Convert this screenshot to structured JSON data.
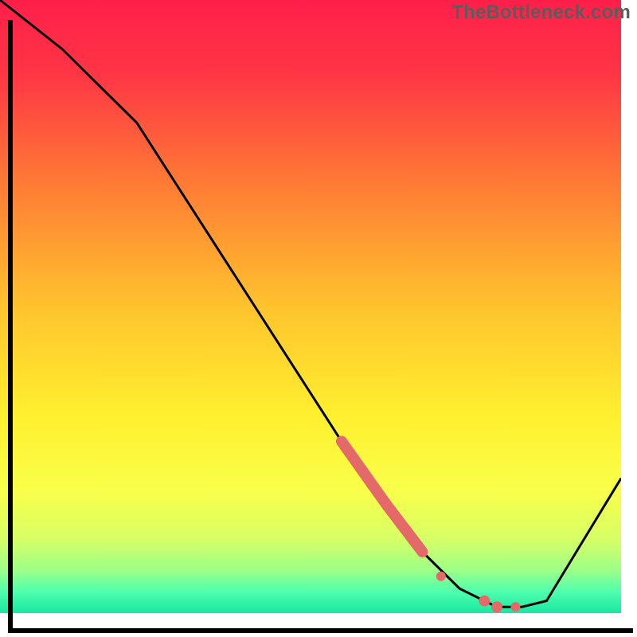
{
  "watermark": "TheBottleneck.com",
  "colors": {
    "curve": "#000000",
    "highlight": "#e46a6a",
    "axis": "#000000"
  },
  "gradient_stops": [
    {
      "offset": 0.0,
      "color": "#ff1f4a"
    },
    {
      "offset": 0.12,
      "color": "#ff3545"
    },
    {
      "offset": 0.3,
      "color": "#ff7b35"
    },
    {
      "offset": 0.5,
      "color": "#ffc32e"
    },
    {
      "offset": 0.68,
      "color": "#fff02f"
    },
    {
      "offset": 0.8,
      "color": "#f9ff4a"
    },
    {
      "offset": 0.88,
      "color": "#d6ff66"
    },
    {
      "offset": 0.93,
      "color": "#9dff88"
    },
    {
      "offset": 0.965,
      "color": "#4fffad"
    },
    {
      "offset": 1.0,
      "color": "#18e7a0"
    }
  ],
  "chart_data": {
    "type": "line",
    "title": "",
    "xlabel": "",
    "ylabel": "",
    "xlim": [
      0,
      100
    ],
    "ylim": [
      0,
      100
    ],
    "series": [
      {
        "name": "bottleneck-curve",
        "x": [
          0,
          10,
          22,
          55,
          62,
          68,
          74,
          80,
          84,
          88,
          100
        ],
        "y": [
          100,
          92,
          80,
          28,
          18,
          10,
          4,
          1,
          1,
          2,
          22
        ]
      }
    ],
    "highlight_segment": {
      "x_start": 55,
      "x_end": 68,
      "stroke_width": 14
    },
    "highlight_markers": [
      {
        "x": 71,
        "y": 6,
        "r": 6
      },
      {
        "x": 78,
        "y": 2,
        "r": 7
      },
      {
        "x": 80,
        "y": 1,
        "r": 7
      },
      {
        "x": 83,
        "y": 1,
        "r": 6
      }
    ]
  }
}
